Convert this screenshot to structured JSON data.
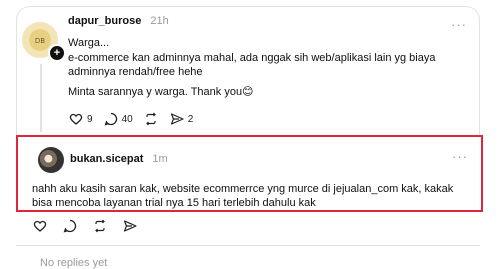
{
  "post": {
    "username": "dapur_burose",
    "time": "21h",
    "lines": [
      "Warga...",
      "e-commerce kan adminnya mahal, ada nggak sih web/aplikasi lain yg biaya adminnya rendah/free hehe",
      "Minta sarannya y warga. Thank you😊"
    ],
    "likes": "9",
    "comments": "40",
    "shares": "2"
  },
  "reply": {
    "username": "bukan.sicepat",
    "time": "1m",
    "text": "nahh aku kasih saran kak, website ecommerrce yng murce di jejualan_com kak, kakak bisa mencoba layanan trial nya 15 hari terlebih dahulu kak"
  },
  "footer": {
    "cut_text": "No replies yet"
  },
  "icons": {
    "more": "more-icon",
    "like": "heart-icon",
    "comment": "comment-icon",
    "repost": "repost-icon",
    "share": "share-icon",
    "add": "plus-icon"
  }
}
